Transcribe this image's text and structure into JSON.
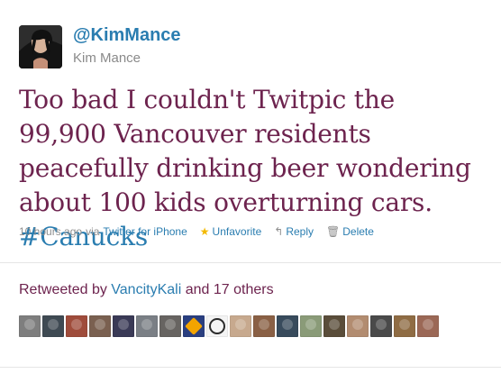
{
  "tweet": {
    "author": {
      "screen_name": "@KimMance",
      "full_name": "Kim Mance"
    },
    "text_parts": {
      "body": "Too bad I couldn't Twitpic the 99,900 Vancouver residents peacefully drinking beer wondering about 100 kids overturning cars. ",
      "hashtag": "#Canucks"
    },
    "meta": {
      "time": "10 hours ago",
      "via": "via",
      "source": "Twitter for iPhone",
      "unfavorite": "Unfavorite",
      "reply": "Reply",
      "delete": "Delete"
    },
    "retweeted": {
      "prefix": "Retweeted by",
      "user": "VancityKali",
      "suffix": "and 17 others"
    },
    "icons": {
      "star": "star-icon",
      "reply": "reply-icon",
      "trash": "trash-icon"
    },
    "colors": {
      "text": "#6d234e",
      "link": "#2a7db0",
      "muted": "#8e8e8e",
      "star": "#f3b900"
    },
    "retweeter_avatars": [
      {
        "name": "retweeter-avatar-1",
        "bg": "#7e7e7e"
      },
      {
        "name": "retweeter-avatar-2",
        "bg": "#3f4a53"
      },
      {
        "name": "retweeter-avatar-3",
        "bg": "#9f4c3b"
      },
      {
        "name": "retweeter-avatar-4",
        "bg": "#7a6050"
      },
      {
        "name": "retweeter-avatar-5",
        "bg": "#3a3a56"
      },
      {
        "name": "retweeter-avatar-6",
        "bg": "#7a7f85"
      },
      {
        "name": "retweeter-avatar-7",
        "bg": "#676461"
      },
      {
        "name": "retweeter-avatar-8",
        "bg": "#2a3f80"
      },
      {
        "name": "retweeter-avatar-9",
        "bg": "#f4f4f4"
      },
      {
        "name": "retweeter-avatar-10",
        "bg": "#c7a98e"
      },
      {
        "name": "retweeter-avatar-11",
        "bg": "#8a6045"
      },
      {
        "name": "retweeter-avatar-12",
        "bg": "#384b5c"
      },
      {
        "name": "retweeter-avatar-13",
        "bg": "#8a9b78"
      },
      {
        "name": "retweeter-avatar-14",
        "bg": "#5a4d3a"
      },
      {
        "name": "retweeter-avatar-15",
        "bg": "#b28c70"
      },
      {
        "name": "retweeter-avatar-16",
        "bg": "#4a4a4a"
      },
      {
        "name": "retweeter-avatar-17",
        "bg": "#8f6c44"
      },
      {
        "name": "retweeter-avatar-18",
        "bg": "#9b6856"
      }
    ]
  }
}
